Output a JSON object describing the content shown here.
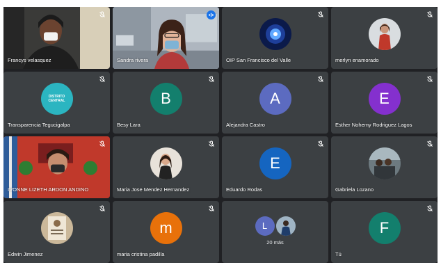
{
  "participants": [
    {
      "name": "Francys velasquez"
    },
    {
      "name": "Sandra rivera"
    },
    {
      "name": "OIP San Francisco del Valle"
    },
    {
      "name": "merlyn enamorado"
    },
    {
      "name": "Transparencia Tegucigalpa",
      "logo_text": "DISTRITO CENTRAL"
    },
    {
      "name": "Besy Lara",
      "initial": "B",
      "color": "#137f6d"
    },
    {
      "name": "Alejandra Castro",
      "initial": "A",
      "color": "#5c6bc0"
    },
    {
      "name": "Esther Nohemy Rodriguez Lagos",
      "initial": "E",
      "color": "#8430ce"
    },
    {
      "name": "IVONNE LIZETH ARDON ANDINO"
    },
    {
      "name": "Maria Jose Mendez Hernandez"
    },
    {
      "name": "Eduardo Rodas",
      "initial": "E",
      "color": "#1565c0"
    },
    {
      "name": "Gabriela Lozano"
    },
    {
      "name": "Edwin Jimenez"
    },
    {
      "name": "maria cristina padilla",
      "initial": "m",
      "color": "#e8710a"
    },
    {
      "more_initial": "L",
      "more_color": "#5c6bc0",
      "more_label": "20 más"
    },
    {
      "name": "Tú",
      "initial": "F",
      "color": "#137f6d"
    }
  ],
  "icons": {
    "mute": "mic-off-icon",
    "speaking": "audio-wave-icon"
  }
}
